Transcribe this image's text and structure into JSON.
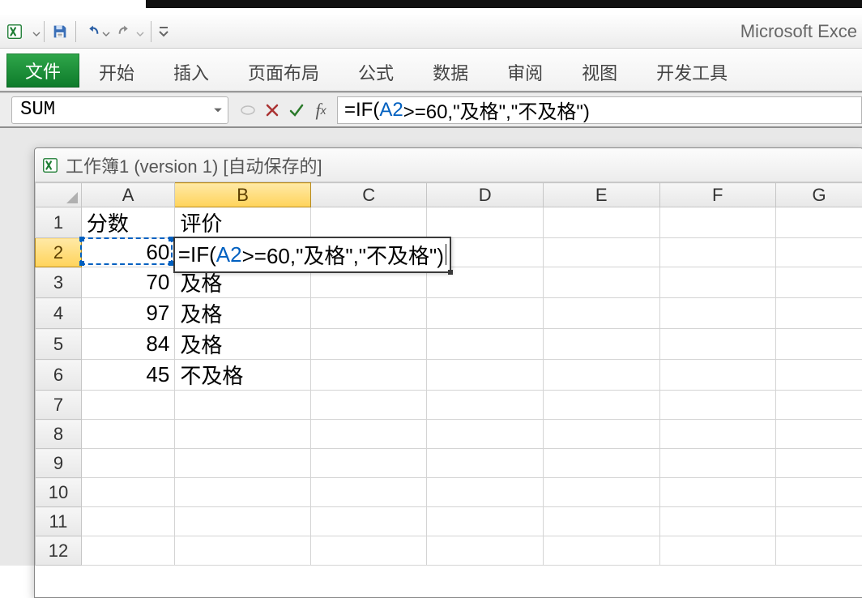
{
  "app_title": "Microsoft Exce",
  "qat": {
    "save": "保存",
    "undo": "撤销",
    "redo": "恢复"
  },
  "ribbon": {
    "file": "文件",
    "tabs": [
      "开始",
      "插入",
      "页面布局",
      "公式",
      "数据",
      "审阅",
      "视图",
      "开发工具"
    ]
  },
  "namebox": "SUM",
  "formula": {
    "prefix": "=IF(",
    "ref": "A2",
    "suffix": ">=60,\"及格\",\"不及格\")"
  },
  "child_window_title": "工作簿1 (version 1) [自动保存的]",
  "columns": [
    "A",
    "B",
    "C",
    "D",
    "E",
    "F",
    "G"
  ],
  "rows": [
    "1",
    "2",
    "3",
    "4",
    "5",
    "6",
    "7",
    "8",
    "9",
    "10",
    "11",
    "12"
  ],
  "selected_col": "B",
  "selected_row": "2",
  "cells": {
    "A1": "分数",
    "B1": "评价",
    "A2": "60",
    "A3": "70",
    "B3": "及格",
    "A4": "97",
    "B4": "及格",
    "A5": "84",
    "B5": "及格",
    "A6": "45",
    "B6": "不及格"
  },
  "editing_cell": "B2"
}
